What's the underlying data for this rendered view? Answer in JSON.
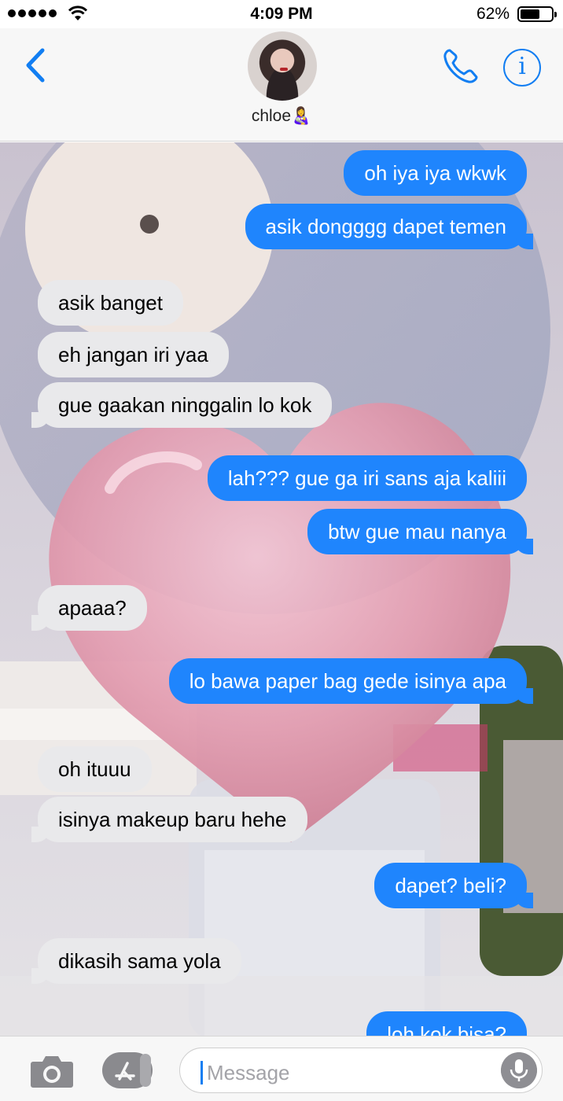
{
  "status_bar": {
    "time": "4:09 PM",
    "battery_percent": "62%",
    "battery_level": 0.62,
    "signal_bars": 5
  },
  "header": {
    "contact_name": "chloe👩‍🍼",
    "back_icon": "chevron-left-icon",
    "call_icon": "phone-icon",
    "info_icon": "info-icon",
    "accent_color": "#127ef2"
  },
  "messages": [
    {
      "side": "sent",
      "text": "oh iya iya wkwk"
    },
    {
      "side": "sent",
      "text": "asik dongggg dapet temen"
    },
    {
      "side": "received",
      "text": "asik banget"
    },
    {
      "side": "received",
      "text": "eh jangan iri yaa"
    },
    {
      "side": "received",
      "text": "gue gaakan ninggalin lo kok"
    },
    {
      "side": "sent",
      "text": "lah??? gue ga iri sans aja kaliii"
    },
    {
      "side": "sent",
      "text": "btw gue mau nanya"
    },
    {
      "side": "received",
      "text": "apaaa?"
    },
    {
      "side": "sent",
      "text": "lo bawa paper bag gede isinya apa"
    },
    {
      "side": "received",
      "text": "oh ituuu"
    },
    {
      "side": "received",
      "text": "isinya makeup baru hehe"
    },
    {
      "side": "sent",
      "text": "dapet? beli?"
    },
    {
      "side": "received",
      "text": "dikasih sama yola"
    },
    {
      "side": "sent",
      "text": "loh kok bisa?"
    }
  ],
  "colors": {
    "sent_bubble": "#1f85fd",
    "received_bubble": "#e9e9eb"
  },
  "input_bar": {
    "placeholder": "Message",
    "camera_icon": "camera-icon",
    "apps_icon": "app-store-icon",
    "mic_icon": "microphone-icon"
  }
}
